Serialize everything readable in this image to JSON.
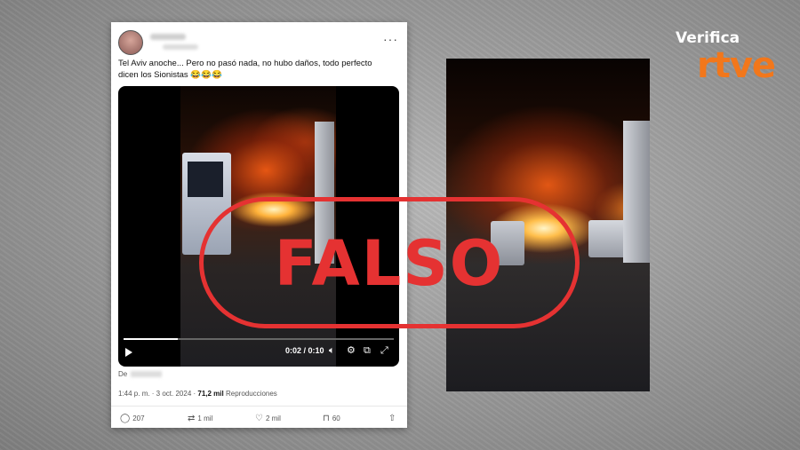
{
  "tweet": {
    "text": "Tel Aviv anoche... Pero no pasó nada, no hubo daños, todo perfecto dicen los Sionistas 😂😂😂",
    "more_icon": "more-dots-icon",
    "video": {
      "time": "0:02 / 0:10",
      "progress": 0.2
    },
    "de_label": "De",
    "meta": {
      "time_date": "1:44 p. m. · 3 oct. 2024 ·",
      "views_count": "71,2 mil",
      "views_label": "Reproducciones"
    },
    "actions": {
      "replies": "207",
      "retweets": "1 mil",
      "likes": "2 mil",
      "bookmarks": "60"
    }
  },
  "stamp": {
    "text": "FALSO",
    "color": "#e53232"
  },
  "logo": {
    "top": "Verifica",
    "main": "rtve",
    "color": "#f2771b"
  }
}
